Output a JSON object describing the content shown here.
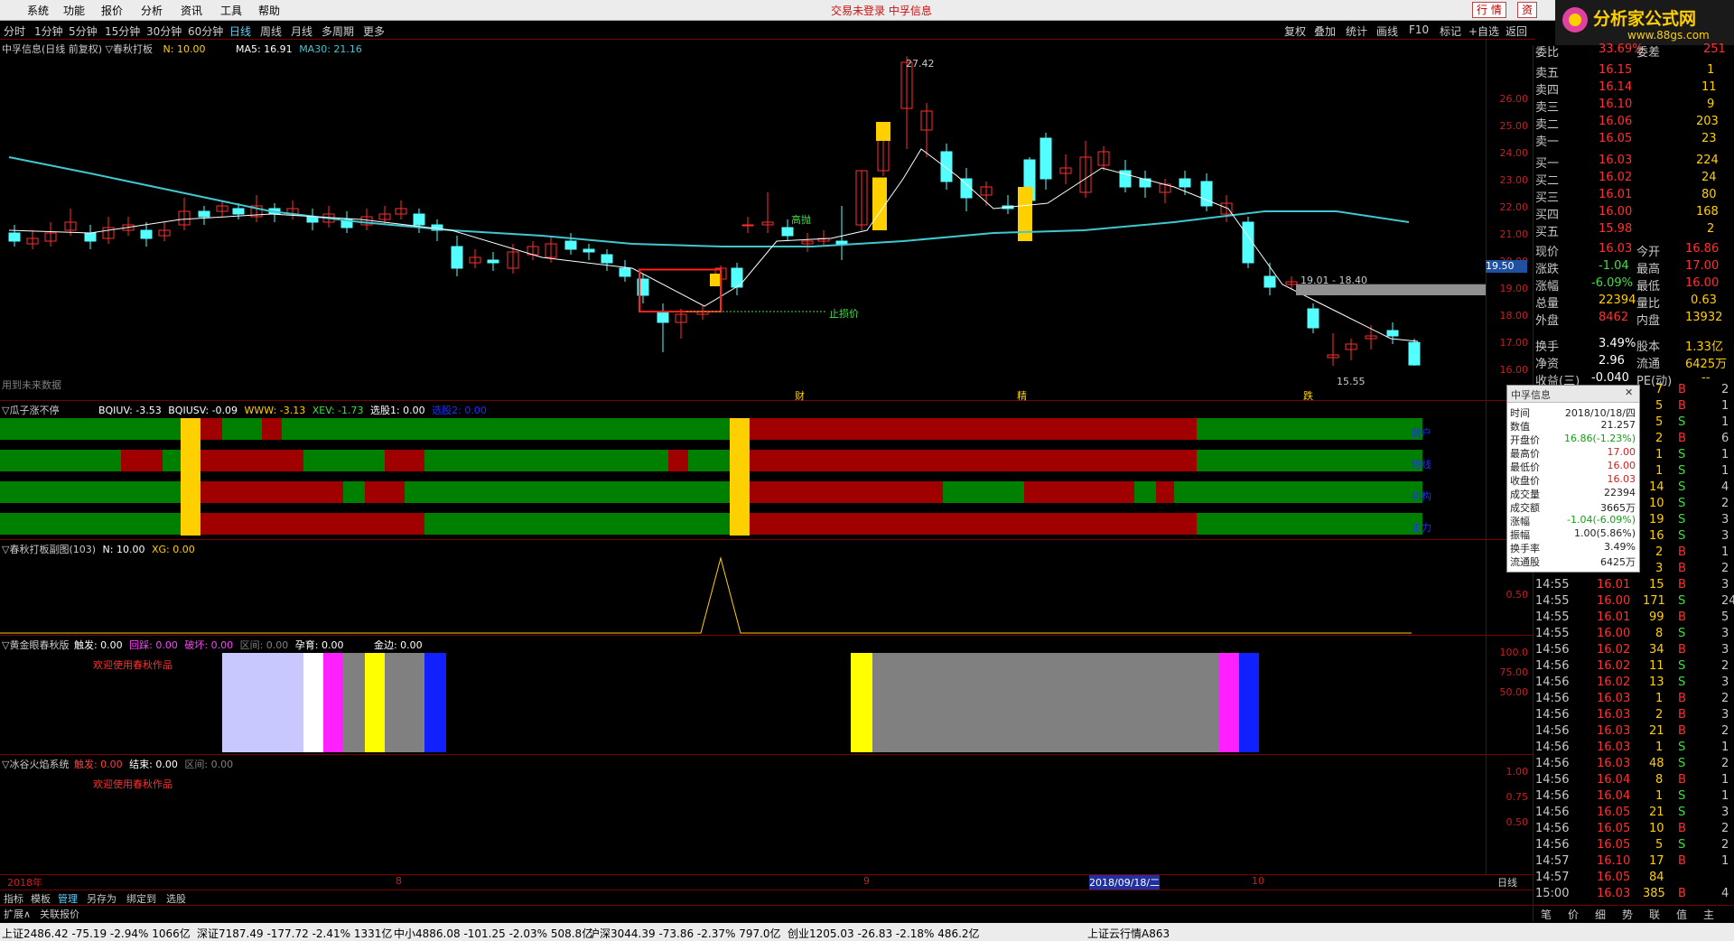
{
  "titlebar": {
    "menus": [
      "系统",
      "功能",
      "报价",
      "分析",
      "资讯",
      "工具",
      "帮助"
    ],
    "center": "交易未登录  中孚信息",
    "btn_hangqing": "行 情",
    "btn_zi": "资",
    "logo": "分析家公式网",
    "logo_url": "www.88gs.com"
  },
  "toolbar": {
    "left": [
      "分时",
      "1分钟",
      "5分钟",
      "15分钟",
      "30分钟",
      "60分钟",
      "日线",
      "周线",
      "月线",
      "多周期",
      "更多"
    ],
    "right": [
      "复权",
      "叠加",
      "统计",
      "画线",
      "F10",
      "标记",
      "+自选",
      "返回"
    ]
  },
  "main_chart": {
    "title": "中孚信息(日线 前复权) ▽春秋打板",
    "n": "N: 10.00",
    "ma5": "MA5: 16.91",
    "ma30": "MA30: 21.16",
    "ticks": [
      "26.00",
      "25.00",
      "24.00",
      "23.00",
      "22.00",
      "21.00",
      "20.00",
      "19.00",
      "18.00",
      "17.00",
      "16.00"
    ],
    "price_tag": "19.50",
    "high_label": "27.42",
    "low_label": "15.55",
    "band_label": "19.01 - 18.40",
    "gaopao": "高抛",
    "zhisun": "止损价",
    "future": "用到未来数据",
    "markers": [
      "财",
      "精",
      "跌"
    ]
  },
  "chart_data": {
    "type": "candlestick",
    "ylim": [
      15.5,
      28.0
    ],
    "high": 27.42,
    "low": 15.55
  },
  "pane1": {
    "title": "▽瓜子涨不停",
    "vals": [
      "BQIUV: -3.53",
      "BQIUSV: -0.09",
      "WWW: -3.13",
      "XEV: -1.73",
      "选股1: 0.00",
      "选股2: 0.00"
    ],
    "labels": [
      "散户",
      "短线",
      "机构",
      "主力"
    ]
  },
  "pane2": {
    "title": "▽春秋打板副图(103)",
    "n": "N: 10.00",
    "xg": "XG: 0.00",
    "tick": "0.50"
  },
  "pane3": {
    "title": "▽黄金眼春秋版",
    "vals": [
      "触发: 0.00",
      "回踩: 0.00",
      "破坏: 0.00",
      "区间: 0.00",
      "孕育: 0.00",
      "金边: 0.00"
    ],
    "note": "欢迎使用春秋作品",
    "ticks": [
      "100.0",
      "75.00",
      "50.00"
    ]
  },
  "pane4": {
    "title": "▽冰谷火焰系统",
    "vals": [
      "触发: 0.00",
      "结束: 0.00",
      "区间: 0.00"
    ],
    "note": "欢迎使用春秋作品",
    "ticks": [
      "1.00",
      "0.75",
      "0.50"
    ]
  },
  "timeaxis": {
    "year": "2018年",
    "m8": "8",
    "m9": "9",
    "date": "2018/09/18/二",
    "m10": "10",
    "period": "日线"
  },
  "tabs": [
    "指标",
    "模板",
    "管理",
    "另存为",
    "绑定到",
    "选股"
  ],
  "tabs2": [
    "扩展∧",
    "关联报价"
  ],
  "quote": {
    "weibi_label": "委比",
    "weibi": "33.69%",
    "weicha_label": "委差",
    "weicha": "251",
    "sells": [
      [
        "卖五",
        "16.15",
        "1"
      ],
      [
        "卖四",
        "16.14",
        "11"
      ],
      [
        "卖三",
        "16.10",
        "9"
      ],
      [
        "卖二",
        "16.06",
        "203"
      ],
      [
        "卖一",
        "16.05",
        "23"
      ]
    ],
    "buys": [
      [
        "买一",
        "16.03",
        "224"
      ],
      [
        "买二",
        "16.02",
        "24"
      ],
      [
        "买三",
        "16.01",
        "80"
      ],
      [
        "买四",
        "16.00",
        "168"
      ],
      [
        "买五",
        "15.98",
        "2"
      ]
    ],
    "stats": [
      [
        "现价",
        "16.03",
        "今开",
        "16.86"
      ],
      [
        "涨跌",
        "-1.04",
        "最高",
        "17.00"
      ],
      [
        "涨幅",
        "-6.09%",
        "最低",
        "16.00"
      ],
      [
        "总量",
        "22394",
        "量比",
        "0.63"
      ],
      [
        "外盘",
        "8462",
        "内盘",
        "13932"
      ],
      [
        "换手",
        "3.49%",
        "股本",
        "1.33亿"
      ],
      [
        "净资",
        "2.96",
        "流通",
        "6425万"
      ],
      [
        "收益(三)",
        "-0.040",
        "PE(动)",
        "--"
      ]
    ]
  },
  "ticks": [
    [
      "",
      "",
      "7",
      "B",
      "2"
    ],
    [
      "",
      "",
      "5",
      "B",
      "1"
    ],
    [
      "",
      "",
      "5",
      "S",
      "1"
    ],
    [
      "",
      "",
      "2",
      "B",
      "6"
    ],
    [
      "",
      "",
      "1",
      "S",
      "1"
    ],
    [
      "",
      "",
      "1",
      "S",
      "1"
    ],
    [
      "",
      "",
      "14",
      "S",
      "4"
    ],
    [
      "",
      "",
      "10",
      "S",
      "2"
    ],
    [
      "",
      "",
      "19",
      "S",
      "3"
    ],
    [
      "",
      "",
      "16",
      "S",
      "3"
    ],
    [
      "",
      "",
      "2",
      "B",
      "1"
    ],
    [
      "",
      "",
      "3",
      "B",
      "2"
    ],
    [
      "14:55",
      "16.01",
      "15",
      "B",
      "3"
    ],
    [
      "14:55",
      "16.00",
      "171",
      "S",
      "24"
    ],
    [
      "14:55",
      "16.01",
      "99",
      "B",
      "5"
    ],
    [
      "14:55",
      "16.00",
      "8",
      "S",
      "3"
    ],
    [
      "14:56",
      "16.02",
      "34",
      "B",
      "3"
    ],
    [
      "14:56",
      "16.02",
      "11",
      "S",
      "2"
    ],
    [
      "14:56",
      "16.02",
      "13",
      "S",
      "3"
    ],
    [
      "14:56",
      "16.03",
      "1",
      "B",
      "2"
    ],
    [
      "14:56",
      "16.03",
      "2",
      "B",
      "3"
    ],
    [
      "14:56",
      "16.03",
      "21",
      "B",
      "2"
    ],
    [
      "14:56",
      "16.03",
      "1",
      "S",
      "1"
    ],
    [
      "14:56",
      "16.03",
      "48",
      "S",
      "2"
    ],
    [
      "14:56",
      "16.04",
      "8",
      "B",
      "1"
    ],
    [
      "14:56",
      "16.04",
      "1",
      "S",
      "1"
    ],
    [
      "14:56",
      "16.05",
      "21",
      "S",
      "3"
    ],
    [
      "14:56",
      "16.05",
      "10",
      "B",
      "2"
    ],
    [
      "14:56",
      "16.05",
      "5",
      "S",
      "2"
    ],
    [
      "14:57",
      "16.10",
      "17",
      "B",
      "1"
    ],
    [
      "14:57",
      "16.05",
      "84",
      "",
      ""
    ],
    [
      "15:00",
      "16.03",
      "385",
      "B",
      "4"
    ]
  ],
  "popup": {
    "title": "中孚信息",
    "rows": [
      [
        "时间",
        "2018/10/18/四"
      ],
      [
        "数值",
        "21.257"
      ],
      [
        "开盘价",
        "16.86(-1.23%)"
      ],
      [
        "最高价",
        "17.00"
      ],
      [
        "最低价",
        "16.00"
      ],
      [
        "收盘价",
        "16.03"
      ],
      [
        "成交量",
        "22394"
      ],
      [
        "成交额",
        "3665万"
      ],
      [
        "涨幅",
        "-1.04(-6.09%)"
      ],
      [
        "振幅",
        "1.00(5.86%)"
      ],
      [
        "换手率",
        "3.49%"
      ],
      [
        "流通股",
        "6425万"
      ]
    ]
  },
  "rp_tabs": [
    "笔",
    "价",
    "细",
    "势",
    "联",
    "值",
    "主"
  ],
  "status": [
    "上证2486.42 -75.19 -2.94% 1066亿",
    "深证7187.49 -177.72 -2.41% 1331亿",
    "中小4886.08 -101.25 -2.03% 508.8亿",
    "沪深3044.39 -73.86 -2.37% 797.0亿",
    "创业1205.03 -26.83 -2.18% 486.2亿",
    "上证云行情A863"
  ]
}
